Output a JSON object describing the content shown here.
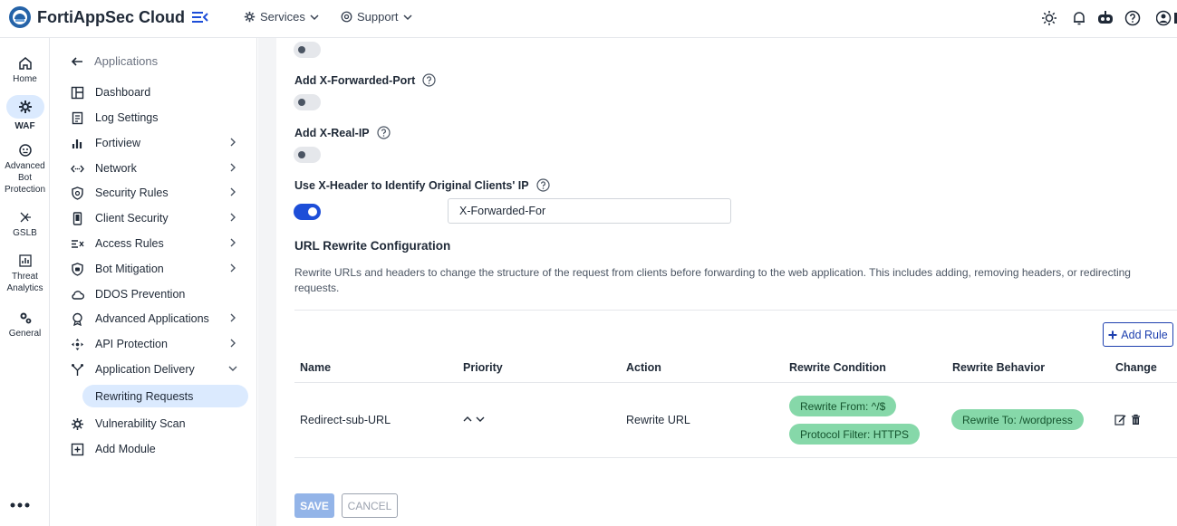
{
  "app": {
    "title": "FortiAppSec Cloud"
  },
  "topnav": {
    "services": "Services",
    "support": "Support"
  },
  "rail": [
    {
      "label": "Home",
      "icon": "home-icon"
    },
    {
      "label": "WAF",
      "icon": "waf-gear-icon",
      "active": true
    },
    {
      "label": "Advanced Bot Protection",
      "icon": "bot-icon"
    },
    {
      "label": "GSLB",
      "icon": "gslb-icon"
    },
    {
      "label": "Threat Analytics",
      "icon": "analytics-icon"
    },
    {
      "label": "General",
      "icon": "general-gear-icon"
    }
  ],
  "sidebar": {
    "back_label": "Applications",
    "items": [
      {
        "label": "Dashboard"
      },
      {
        "label": "Log Settings"
      },
      {
        "label": "Fortiview"
      },
      {
        "label": "Network"
      },
      {
        "label": "Security Rules"
      },
      {
        "label": "Client Security"
      },
      {
        "label": "Access Rules"
      },
      {
        "label": "Bot Mitigation"
      },
      {
        "label": "DDOS Prevention"
      },
      {
        "label": "Advanced Applications"
      },
      {
        "label": "API Protection"
      },
      {
        "label": "Application Delivery"
      },
      {
        "label": "Vulnerability Scan"
      },
      {
        "label": "Add Module"
      }
    ],
    "active_sub": "Rewriting Requests"
  },
  "form": {
    "x_forwarded_port_label": "Add X-Forwarded-Port",
    "x_real_ip_label": "Add X-Real-IP",
    "x_header_label": "Use X-Header to Identify Original Clients' IP",
    "x_header_value": "X-Forwarded-For"
  },
  "rewrite": {
    "title": "URL Rewrite Configuration",
    "description": "Rewrite URLs and headers to change the structure of the request from clients before forwarding to the web application. This includes adding, removing headers, or redirecting requests.",
    "add_rule_label": "Add Rule",
    "columns": [
      "Name",
      "Priority",
      "Action",
      "Rewrite Condition",
      "Rewrite Behavior",
      "Change"
    ],
    "rows": [
      {
        "name": "Redirect-sub-URL",
        "action": "Rewrite URL",
        "conditions": [
          "Rewrite From: ^/$",
          "Protocol Filter: HTTPS"
        ],
        "behavior": "Rewrite To: /wordpress"
      }
    ]
  },
  "actions": {
    "save": "SAVE",
    "cancel": "CANCEL"
  },
  "colors": {
    "accent": "#1d4ed8",
    "pill": "#86d8a9",
    "active_bg": "#dbeafe"
  }
}
